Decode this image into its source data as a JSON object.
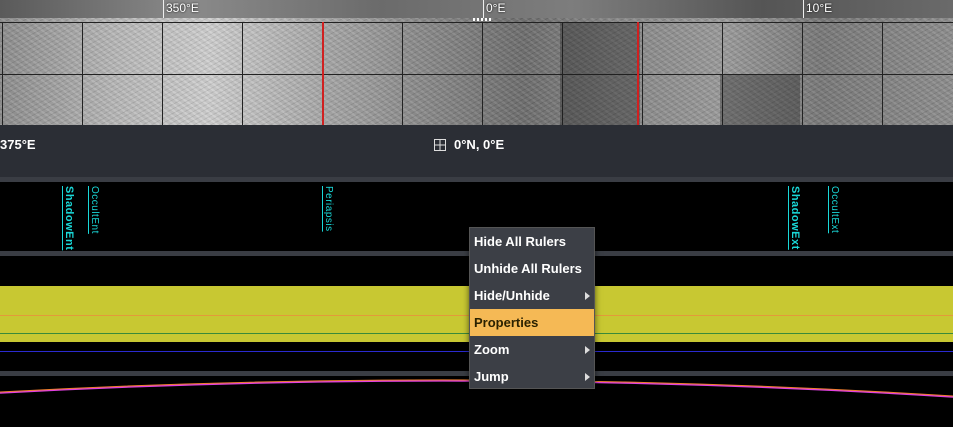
{
  "longitude_labels": {
    "left": "350°E",
    "center": "0°E",
    "right": "10°E"
  },
  "coordinate_bar": {
    "left_readout": "375°E",
    "center_readout": "0°N, 0°E"
  },
  "events": [
    "ShadowEnt",
    "OccultEnt",
    "Periapsis",
    "ShadowExt",
    "OccultExt"
  ],
  "context_menu": {
    "items": [
      {
        "label": "Hide All Rulers",
        "submenu": false
      },
      {
        "label": "Unhide All Rulers",
        "submenu": false
      },
      {
        "label": "Hide/Unhide",
        "submenu": true
      },
      {
        "label": "Properties",
        "submenu": false,
        "active": true
      },
      {
        "label": "Zoom",
        "submenu": true
      },
      {
        "label": "Jump",
        "submenu": true
      }
    ]
  },
  "colors": {
    "event_text": "#19d8d8",
    "band": "#c8c832",
    "menu_active": "#f5b955",
    "marker_line": "#d02020"
  }
}
